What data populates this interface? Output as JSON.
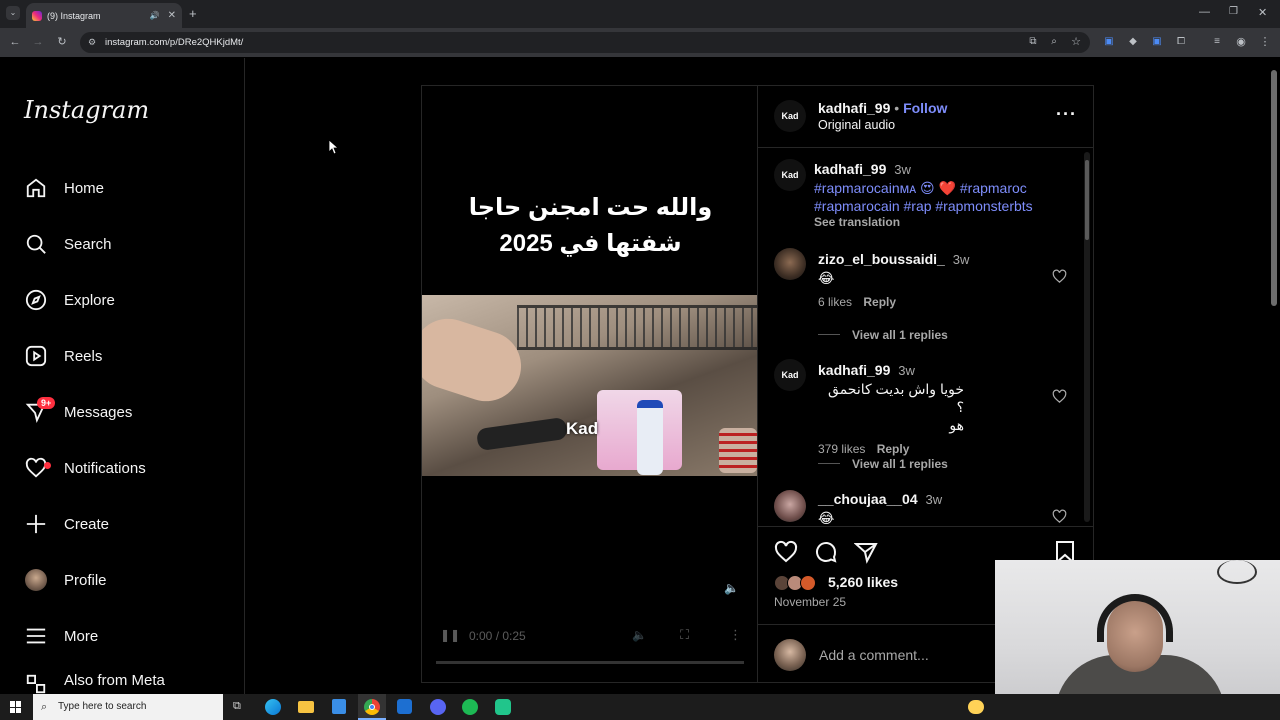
{
  "browser": {
    "tab_title": "(9) Instagram",
    "url": "instagram.com/p/DRe2QHKjdMt/"
  },
  "sidebar": {
    "logo": "Instagram",
    "items": [
      {
        "label": "Home",
        "icon": "home-icon"
      },
      {
        "label": "Search",
        "icon": "search-icon"
      },
      {
        "label": "Explore",
        "icon": "compass-icon"
      },
      {
        "label": "Reels",
        "icon": "reels-icon"
      },
      {
        "label": "Messages",
        "icon": "messenger-icon",
        "badge": "9+"
      },
      {
        "label": "Notifications",
        "icon": "heart-icon",
        "dot": true
      },
      {
        "label": "Create",
        "icon": "plus-icon"
      },
      {
        "label": "Profile",
        "icon": "avatar"
      },
      {
        "label": "More",
        "icon": "menu-icon"
      },
      {
        "label": "Also from Meta",
        "icon": "meta-icon"
      }
    ]
  },
  "video": {
    "caption_line1": "والله حت امجنن حاجا",
    "caption_line2": "شفتها في 2025",
    "watermark": "Kad",
    "time": "0:00 / 0:25"
  },
  "post": {
    "author": "kadhafi_99",
    "follow_label": "Follow",
    "audio": "Original audio",
    "author_avatar_text": "Kad",
    "caption": {
      "user": "kadhafi_99",
      "age": "3w",
      "line1": "#rapmarocainᴍᴀ 😍 ❤️ #rapmaroc",
      "line2": "#rapmarocain #rap #rapmonsterbts",
      "see_translation": "See translation"
    },
    "comments": [
      {
        "user": "zizo_el_boussaidi_",
        "age": "3w",
        "text": "😂",
        "likes": "6 likes",
        "reply": "Reply",
        "view_replies": "View all 1 replies"
      },
      {
        "user": "kadhafi_99",
        "age": "3w",
        "text_line1": "خويا واش بديت كانحمق ؟",
        "text_line2": "هو",
        "likes": "379 likes",
        "reply": "Reply",
        "view_replies": "View all 1 replies"
      },
      {
        "user": "__choujaa__04",
        "age": "3w",
        "text": "😂"
      }
    ],
    "likes": "5,260 likes",
    "date": "November 25",
    "add_comment_placeholder": "Add a comment..."
  },
  "taskbar": {
    "search_placeholder": "Type here to search"
  },
  "colors": {
    "accent": "#7e8dfb",
    "badge": "#ff3040",
    "background": "#000000"
  }
}
